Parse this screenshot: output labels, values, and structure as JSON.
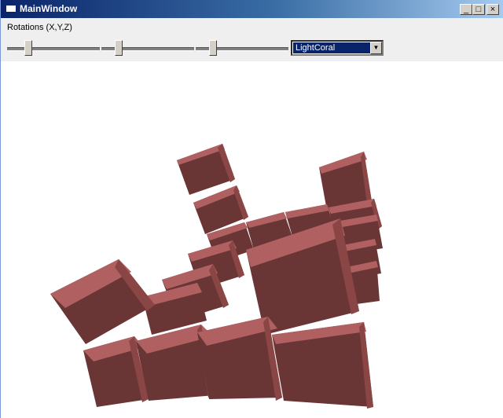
{
  "window": {
    "title": "MainWindow"
  },
  "caption_buttons": {
    "min": "_",
    "max": "□",
    "close": "×"
  },
  "toolbar": {
    "rotations_label": "Rotations (X,Y,Z)",
    "sliders": [
      {
        "axis": "X",
        "level": 0.22
      },
      {
        "axis": "Y",
        "level": 0.18
      },
      {
        "axis": "Z",
        "level": 0.18
      }
    ],
    "color_select": {
      "selected": "LightCoral"
    }
  },
  "scene": {
    "cube_color": "#a05555",
    "face_colors": {
      "top": "#b06060",
      "front": "#6a3535",
      "side": "#8a4545"
    }
  }
}
